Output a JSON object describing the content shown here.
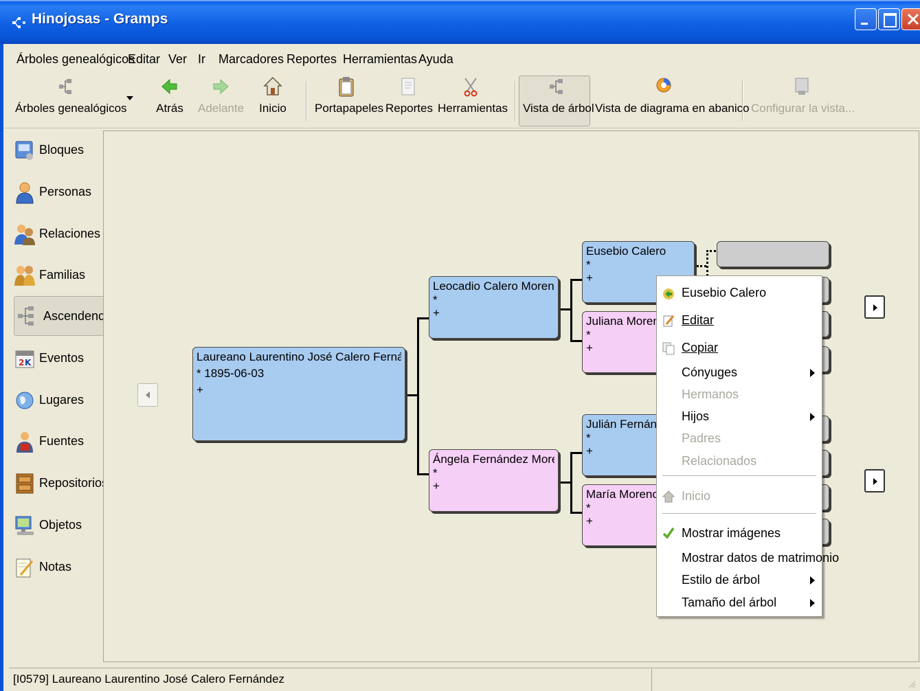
{
  "window": {
    "title": "Hinojosas - Gramps"
  },
  "menubar": {
    "items": [
      "Árboles genealógicos",
      "Editar",
      "Ver",
      "Ir",
      "Marcadores",
      "Reportes",
      "Herramientas",
      "Ayuda"
    ]
  },
  "toolbar": {
    "family_trees": "Árboles genealógicos",
    "back": "Atrás",
    "forward": "Adelante",
    "home": "Inicio",
    "clipboard": "Portapapeles",
    "reports": "Reportes",
    "tools": "Herramientas",
    "tree_view": "Vista de árbol",
    "fan_view": "Vista de diagrama en abanico",
    "configure": "Configurar la vista..."
  },
  "sidebar": {
    "items": [
      {
        "label": "Bloques",
        "icon": "gramplets-icon"
      },
      {
        "label": "Personas",
        "icon": "person-icon"
      },
      {
        "label": "Relaciones",
        "icon": "relationships-icon"
      },
      {
        "label": "Familias",
        "icon": "families-icon"
      },
      {
        "label": "Ascendencia",
        "icon": "pedigree-icon",
        "active": true
      },
      {
        "label": "Eventos",
        "icon": "events-icon"
      },
      {
        "label": "Lugares",
        "icon": "places-icon"
      },
      {
        "label": "Fuentes",
        "icon": "sources-icon"
      },
      {
        "label": "Repositorios",
        "icon": "repositories-icon"
      },
      {
        "label": "Objetos",
        "icon": "media-icon"
      },
      {
        "label": "Notas",
        "icon": "notes-icon"
      }
    ]
  },
  "tree": {
    "root": {
      "name": "Laureano Laurentino José Calero Fernández",
      "birth": "* 1895-06-03",
      "death": "+"
    },
    "father": {
      "name": "Leocadio Calero Moreno",
      "birth": "*",
      "death": "+"
    },
    "mother": {
      "name": "Ángela Fernández Moreno",
      "birth": "*",
      "death": "+"
    },
    "ff": {
      "name": "Eusebio Calero",
      "birth": "*",
      "death": "+"
    },
    "fm": {
      "name": "Juliana Moreno",
      "birth": "*",
      "death": "+"
    },
    "mf": {
      "name": "Julián Fernández",
      "birth": "*",
      "death": "+"
    },
    "mm": {
      "name": "María Moreno",
      "birth": "*",
      "death": "+"
    }
  },
  "context_menu": {
    "items": [
      {
        "label": "Eusebio Calero",
        "icon": "go-person-icon"
      },
      {
        "label": "Editar",
        "icon": "edit-icon"
      },
      {
        "label": "Copiar",
        "icon": "copy-icon"
      },
      {
        "label": "Cónyuges",
        "submenu": true
      },
      {
        "label": "Hermanos",
        "disabled": true
      },
      {
        "label": "Hijos",
        "submenu": true
      },
      {
        "label": "Padres",
        "disabled": true
      },
      {
        "label": "Relacionados",
        "disabled": true
      },
      {
        "label": "Inicio",
        "icon": "home-icon",
        "disabled": true
      },
      {
        "label": "Mostrar imágenes",
        "icon": "checkmark-icon"
      },
      {
        "label": "Mostrar datos de matrimonio"
      },
      {
        "label": "Estilo de árbol",
        "submenu": true
      },
      {
        "label": "Tamaño del árbol",
        "submenu": true
      }
    ]
  },
  "statusbar": {
    "text": "[I0579] Laureano Laurentino José Calero Fernández"
  },
  "colors": {
    "male": "#a8cbf0",
    "female": "#f6cff6",
    "titlebar": "#0a5ee8"
  }
}
